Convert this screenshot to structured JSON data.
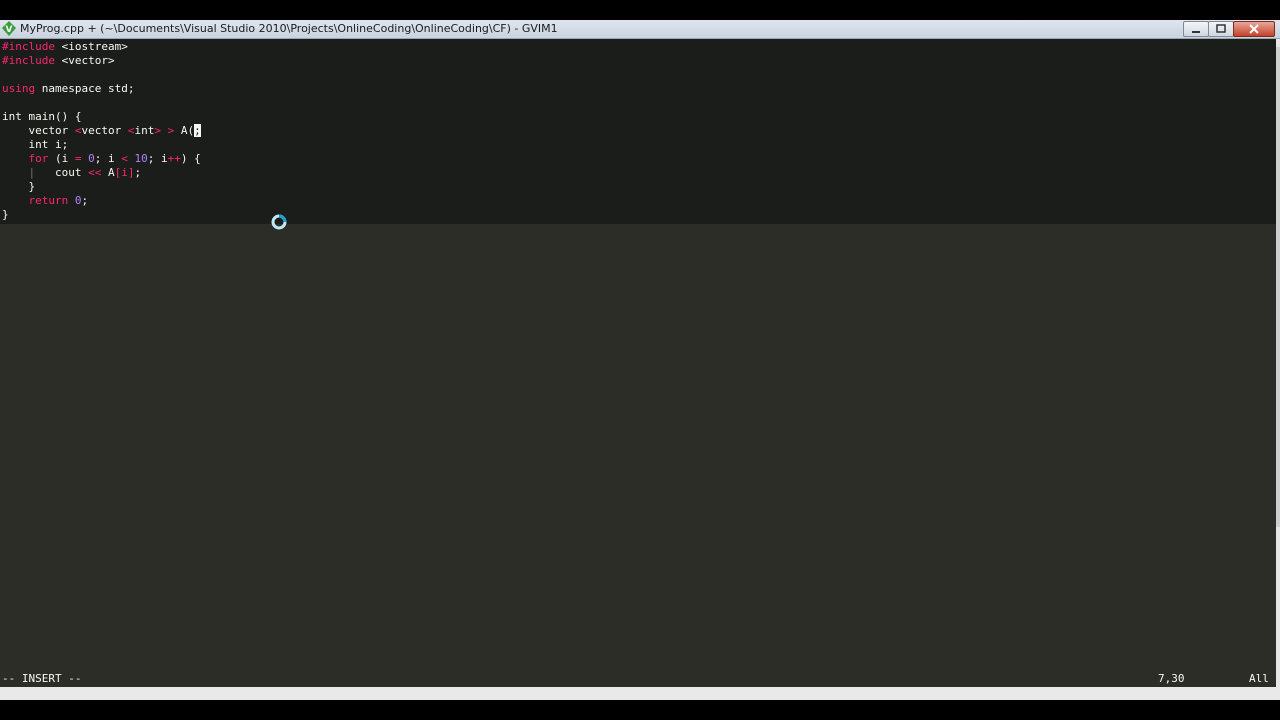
{
  "window": {
    "title": "MyProg.cpp + (~\\Documents\\Visual Studio 2010\\Projects\\OnlineCoding\\OnlineCoding\\CF) - GVIM1",
    "app_icon": "gvim-icon"
  },
  "controls": {
    "minimize_icon": "minimize-icon",
    "maximize_icon": "maximize-icon",
    "close_icon": "close-icon"
  },
  "code": {
    "line1": {
      "pre": "#include",
      "rest": " <iostream>"
    },
    "line2": {
      "pre": "#include",
      "rest": " <vector>"
    },
    "line4": {
      "kw": "using",
      "rest": " namespace std;"
    },
    "line6": {
      "text": "int main() {"
    },
    "line7": {
      "a": "    vector ",
      "op1": "<",
      "b": "vector ",
      "op2": "<",
      "c": "int",
      "op3": "> > ",
      "d": "A(",
      "cursor": ";"
    },
    "line8": {
      "text": "    int i;"
    },
    "line9": {
      "kw": "for",
      "a": " (i ",
      "op1": "=",
      "sp1": " ",
      "n1": "0",
      "b": "; i ",
      "op2": "<",
      "sp2": " ",
      "n2": "10",
      "c": "; i",
      "op3": "++",
      "d": ") {"
    },
    "line10": {
      "guide": "|",
      "a": "   cout ",
      "op": "<<",
      "b": " A",
      "br": "[i]",
      "c": ";"
    },
    "line11": {
      "text": "    }"
    },
    "line12": {
      "kw": "return",
      "sp": " ",
      "num": "0",
      "c": ";"
    },
    "line13": {
      "text": "}"
    }
  },
  "status": {
    "mode": "-- INSERT --",
    "position": "7,30",
    "scroll": "All"
  },
  "colors": {
    "background": "#2d2d27",
    "code_bg": "#1b1d1a",
    "keyword": "#f92672",
    "number": "#ae81ff",
    "text": "#f8f8f2"
  },
  "cursor_icon": "loading-spinner-icon"
}
